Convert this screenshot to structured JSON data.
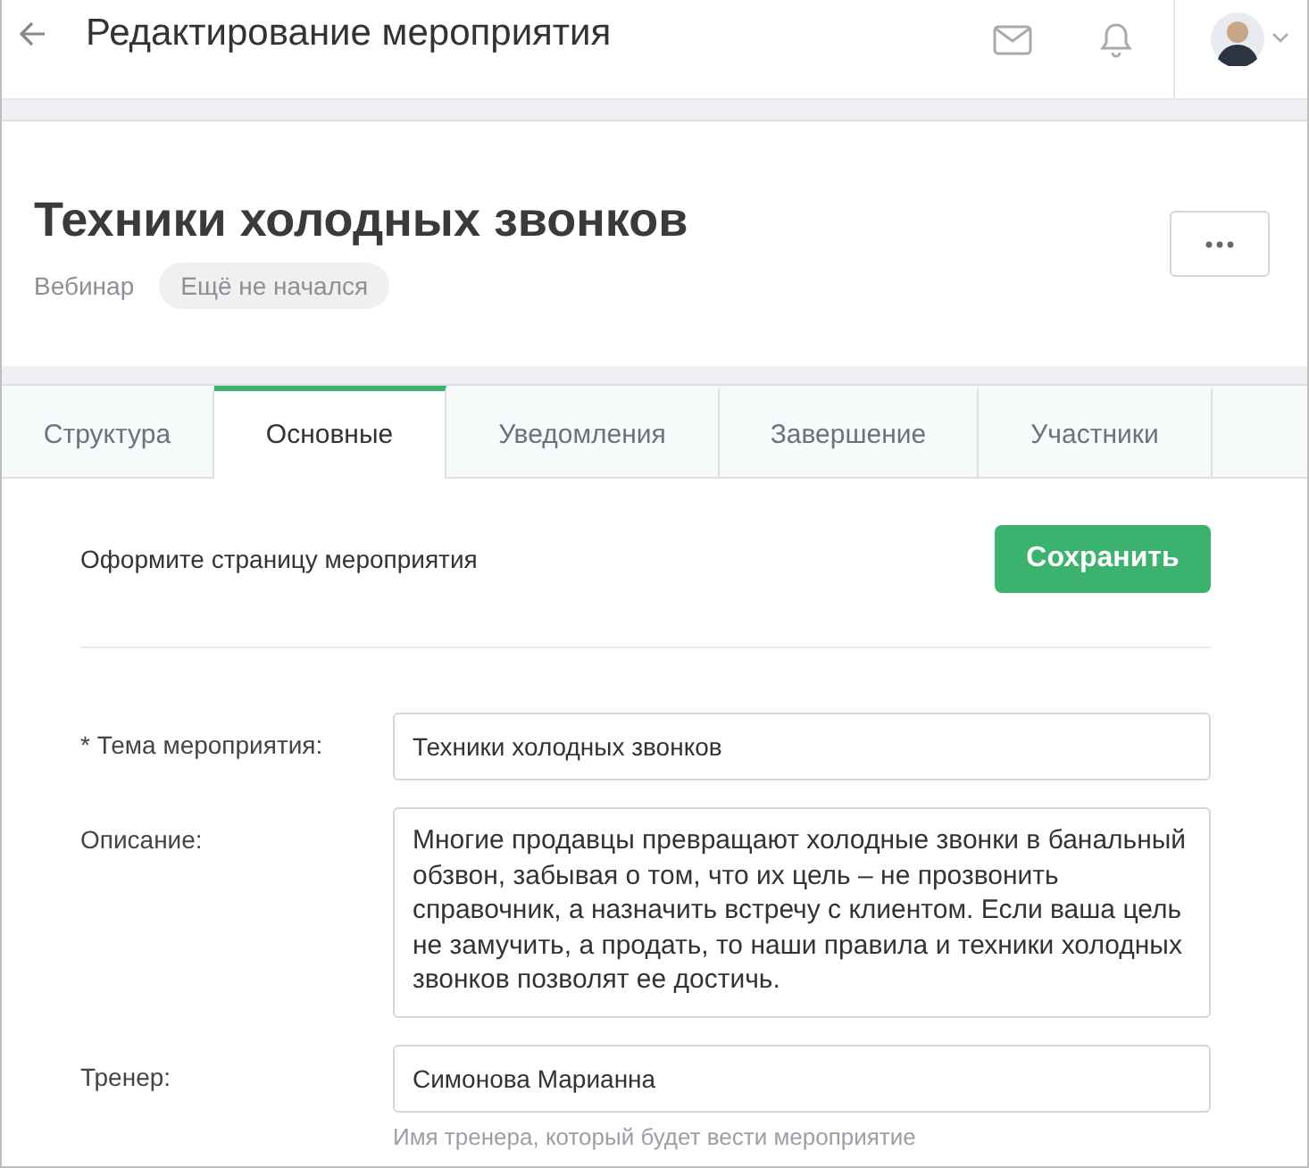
{
  "header": {
    "title": "Редактирование мероприятия"
  },
  "event": {
    "title": "Техники холодных звонков",
    "type": "Вебинар",
    "status": "Ещё не начался"
  },
  "tabs": [
    {
      "label": "Структура",
      "selected": false
    },
    {
      "label": "Основные",
      "selected": true
    },
    {
      "label": "Уведомления",
      "selected": false
    },
    {
      "label": "Завершение",
      "selected": false
    },
    {
      "label": "Участники",
      "selected": false
    }
  ],
  "section": {
    "title": "Оформите страницу мероприятия",
    "save_button": "Сохранить"
  },
  "fields": [
    {
      "kind": "input",
      "label": "* Тема мероприятия:",
      "value": "Техники холодных звонков"
    },
    {
      "kind": "textarea",
      "label": "Описание:",
      "value": "Многие продавцы превращают холодные звонки в банальный обзвон, забывая о том, что их цель – не прозвонить справочник, а назначить встречу с клиентом. Если ваша цель не замучить, а продать, то наши правила и техники холодных звонков позволят ее достичь."
    },
    {
      "kind": "input",
      "label": "Тренер:",
      "value": "Симонова Марианна",
      "hint": "Имя тренера, который будет вести мероприятие"
    }
  ]
}
